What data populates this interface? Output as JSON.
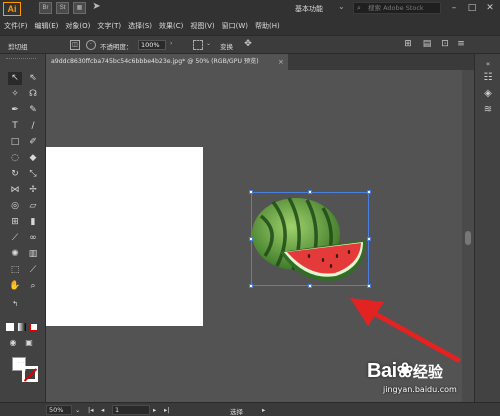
{
  "app": {
    "logo": "Ai",
    "title_icons": [
      "Br",
      "St"
    ]
  },
  "workspace": {
    "label": "基本功能"
  },
  "search": {
    "placeholder": "搜索 Adobe Stock"
  },
  "menu": [
    "文件(F)",
    "编辑(E)",
    "对象(O)",
    "文字(T)",
    "选择(S)",
    "效果(C)",
    "视图(V)",
    "窗口(W)",
    "帮助(H)"
  ],
  "control_bar": {
    "group_label": "剪切组",
    "opacity_label": "不透明度：",
    "opacity_value": "100%",
    "transform_label": "变换"
  },
  "document_tab": {
    "title": "a9ddc8630ffcba745bc54c6bbbe4b23e.jpg* @ 50% (RGB/GPU 预览)",
    "close": "×"
  },
  "status_bar": {
    "zoom": "50%",
    "artboard_number": "1",
    "tool_status": "选择"
  },
  "watermark": {
    "brand": "Bai",
    "brand_suffix": "经验",
    "url": "jingyan.baidu.com"
  },
  "colors": {
    "accent": "#ff9a00",
    "selection": "#4a7fe0",
    "arrow": "#e32222",
    "ui_dark": "#323232",
    "canvas": "#535353"
  }
}
